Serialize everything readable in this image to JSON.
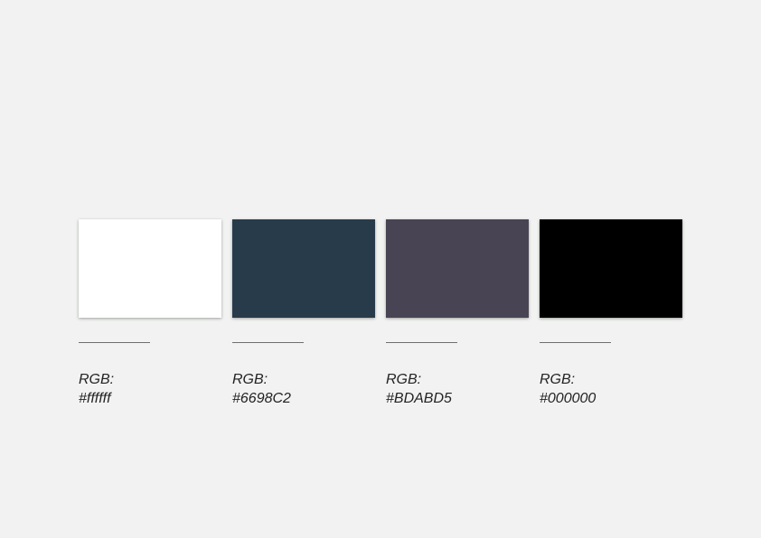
{
  "swatches": [
    {
      "color": "#ffffff",
      "label": "RGB:",
      "value": "#ffffff"
    },
    {
      "color": "#283b4a",
      "label": "RGB:",
      "value": "#6698C2"
    },
    {
      "color": "#494454",
      "label": "RGB:",
      "value": "#BDABD5"
    },
    {
      "color": "#000000",
      "label": "RGB:",
      "value": "#000000"
    }
  ],
  "background": "#f1f2f1"
}
